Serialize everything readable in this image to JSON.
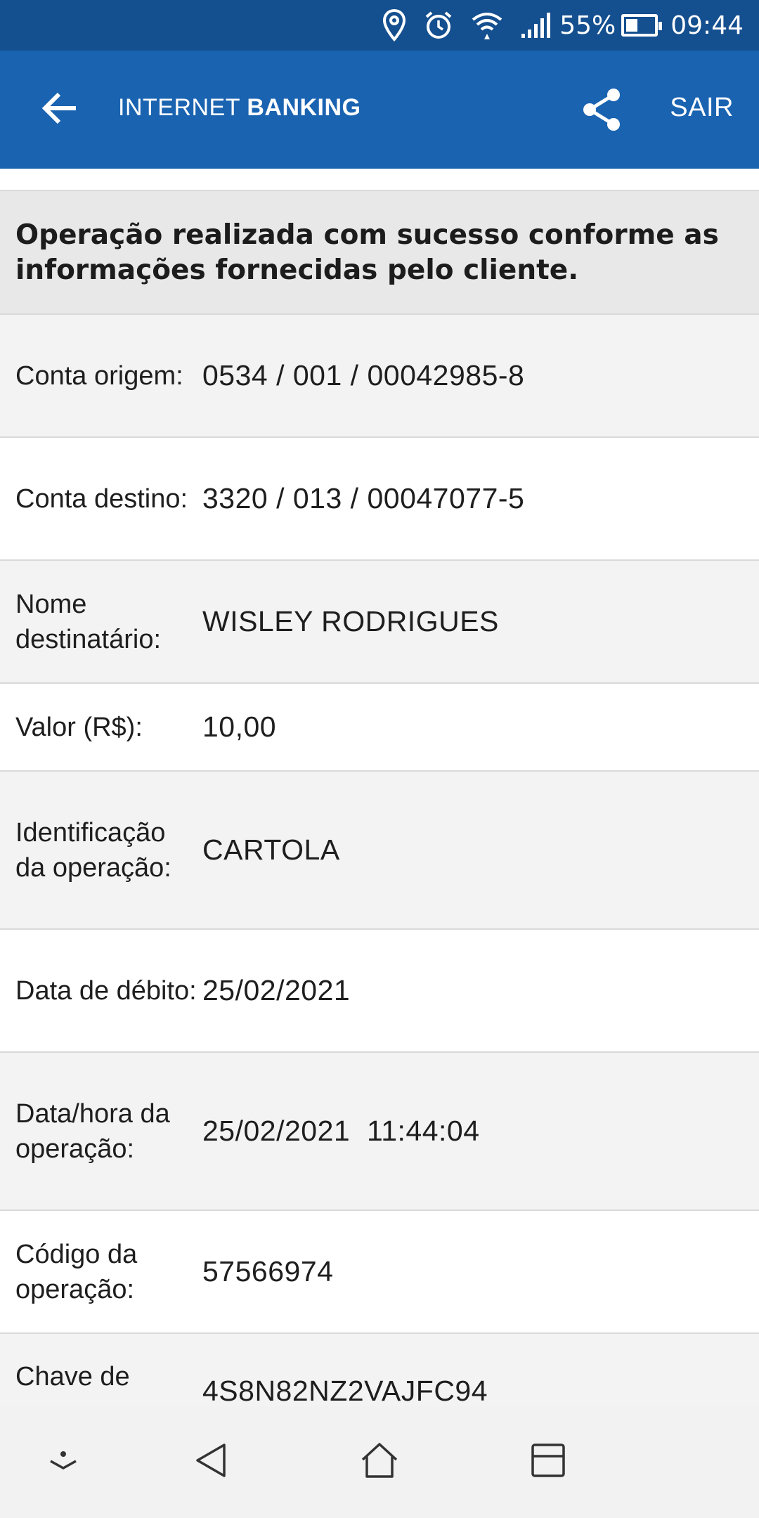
{
  "status_bar": {
    "battery_percent": "55%",
    "time": "09:44",
    "icons": [
      "location-icon",
      "alarm-icon",
      "wifi-icon",
      "signal-icon",
      "battery-icon"
    ]
  },
  "app_bar": {
    "title_light": "INTERNET ",
    "title_bold": "BANKING",
    "logout_label": "SAIR",
    "icons": [
      "back-arrow-icon",
      "share-icon"
    ]
  },
  "banner": {
    "message": "Operação realizada com sucesso conforme as informações fornecidas pelo cliente."
  },
  "details": [
    {
      "label": "Conta origem:",
      "value": "0534 / 001 / 00042985-8"
    },
    {
      "label": "Conta destino:",
      "value": "3320 / 013 / 00047077-5"
    },
    {
      "label": "Nome destinatário:",
      "value": "WISLEY RODRIGUES"
    },
    {
      "label": "Valor (R$):",
      "value": "10,00"
    },
    {
      "label": "Identificação da operação:",
      "value": "CARTOLA"
    },
    {
      "label": "Data de débito:",
      "value": "25/02/2021"
    },
    {
      "label": "Data/hora da operação:",
      "value": "25/02/2021  11:44:04"
    },
    {
      "label": "Código da operação:",
      "value": "57566974"
    },
    {
      "label": "Chave de",
      "value": "4S8N82NZ2VAJFC94"
    }
  ],
  "nav_bar": {
    "icons": [
      "hide-nav-icon",
      "back-triangle-icon",
      "home-icon",
      "recents-icon"
    ]
  }
}
